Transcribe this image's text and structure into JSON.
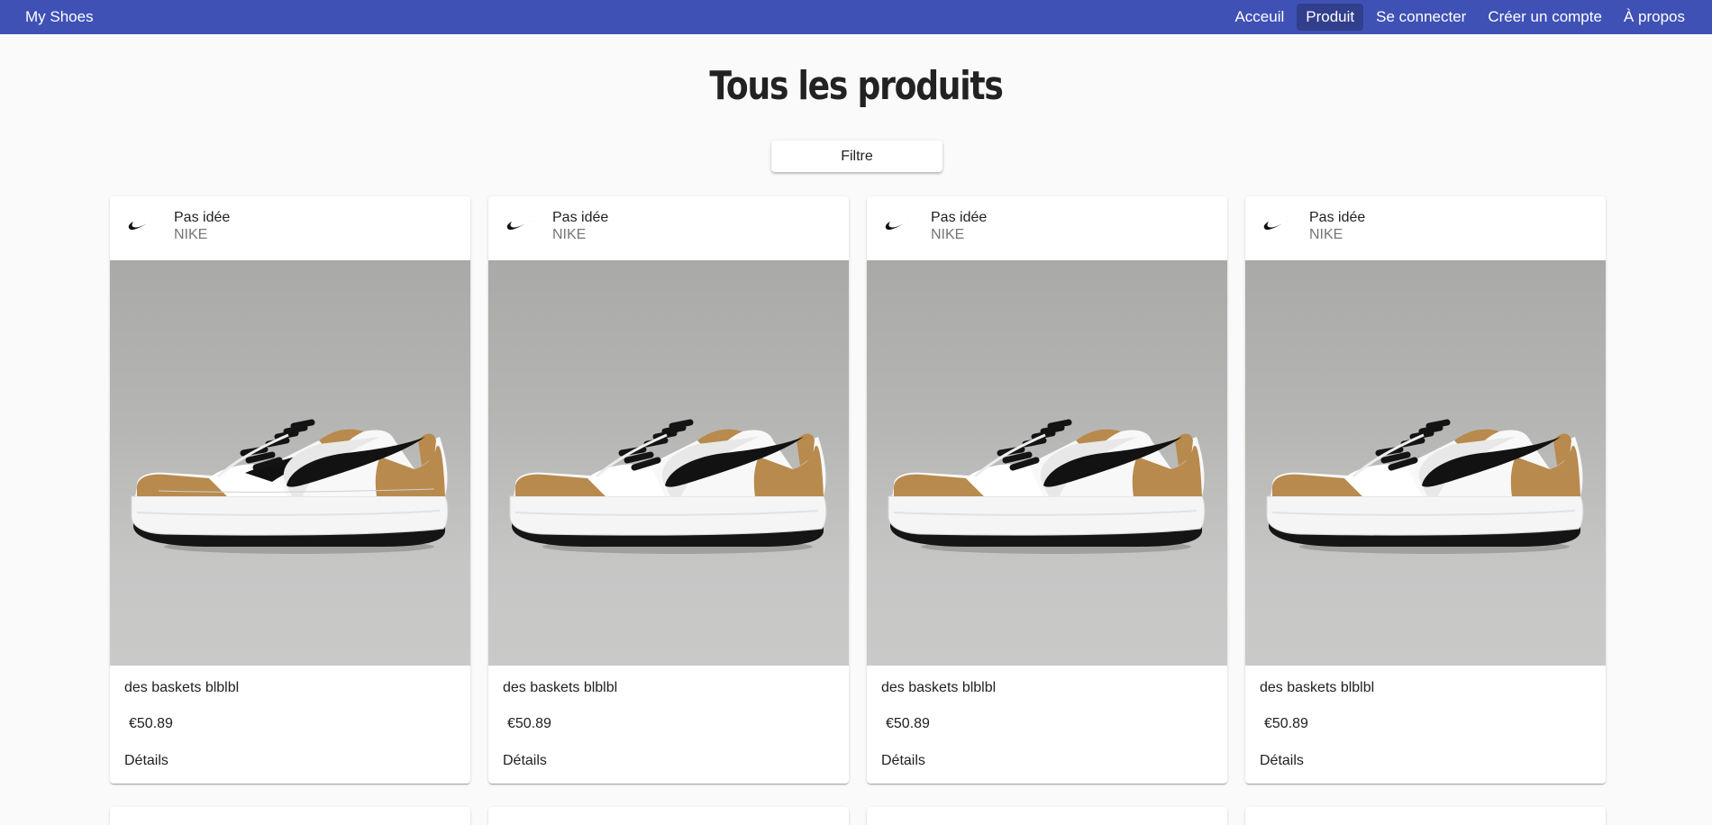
{
  "app": {
    "brand": "My Shoes"
  },
  "nav": {
    "items": [
      {
        "label": "Acceuil",
        "active": false
      },
      {
        "label": "Produit",
        "active": true
      },
      {
        "label": "Se connecter",
        "active": false
      },
      {
        "label": "Créer un compte",
        "active": false
      },
      {
        "label": "À propos",
        "active": false
      }
    ]
  },
  "page": {
    "title": "Tous les produits",
    "filter_label": "Filtre"
  },
  "products": [
    {
      "title": "Pas idée",
      "brand": "NIKE",
      "description": "des baskets blblbl",
      "price": "€50.89",
      "details_label": "Détails",
      "logo_icon": "nike-swoosh-icon"
    },
    {
      "title": "Pas idée",
      "brand": "NIKE",
      "description": "des baskets blblbl",
      "price": "€50.89",
      "details_label": "Détails",
      "logo_icon": "nike-swoosh-icon"
    },
    {
      "title": "Pas idée",
      "brand": "NIKE",
      "description": "des baskets blblbl",
      "price": "€50.89",
      "details_label": "Détails",
      "logo_icon": "nike-swoosh-icon"
    },
    {
      "title": "Pas idée",
      "brand": "NIKE",
      "description": "des baskets blblbl",
      "price": "€50.89",
      "details_label": "Détails",
      "logo_icon": "nike-swoosh-icon"
    }
  ],
  "colors": {
    "toolbar": "#3f51b5",
    "background": "#fafafa",
    "suede": "#b88a4e"
  }
}
